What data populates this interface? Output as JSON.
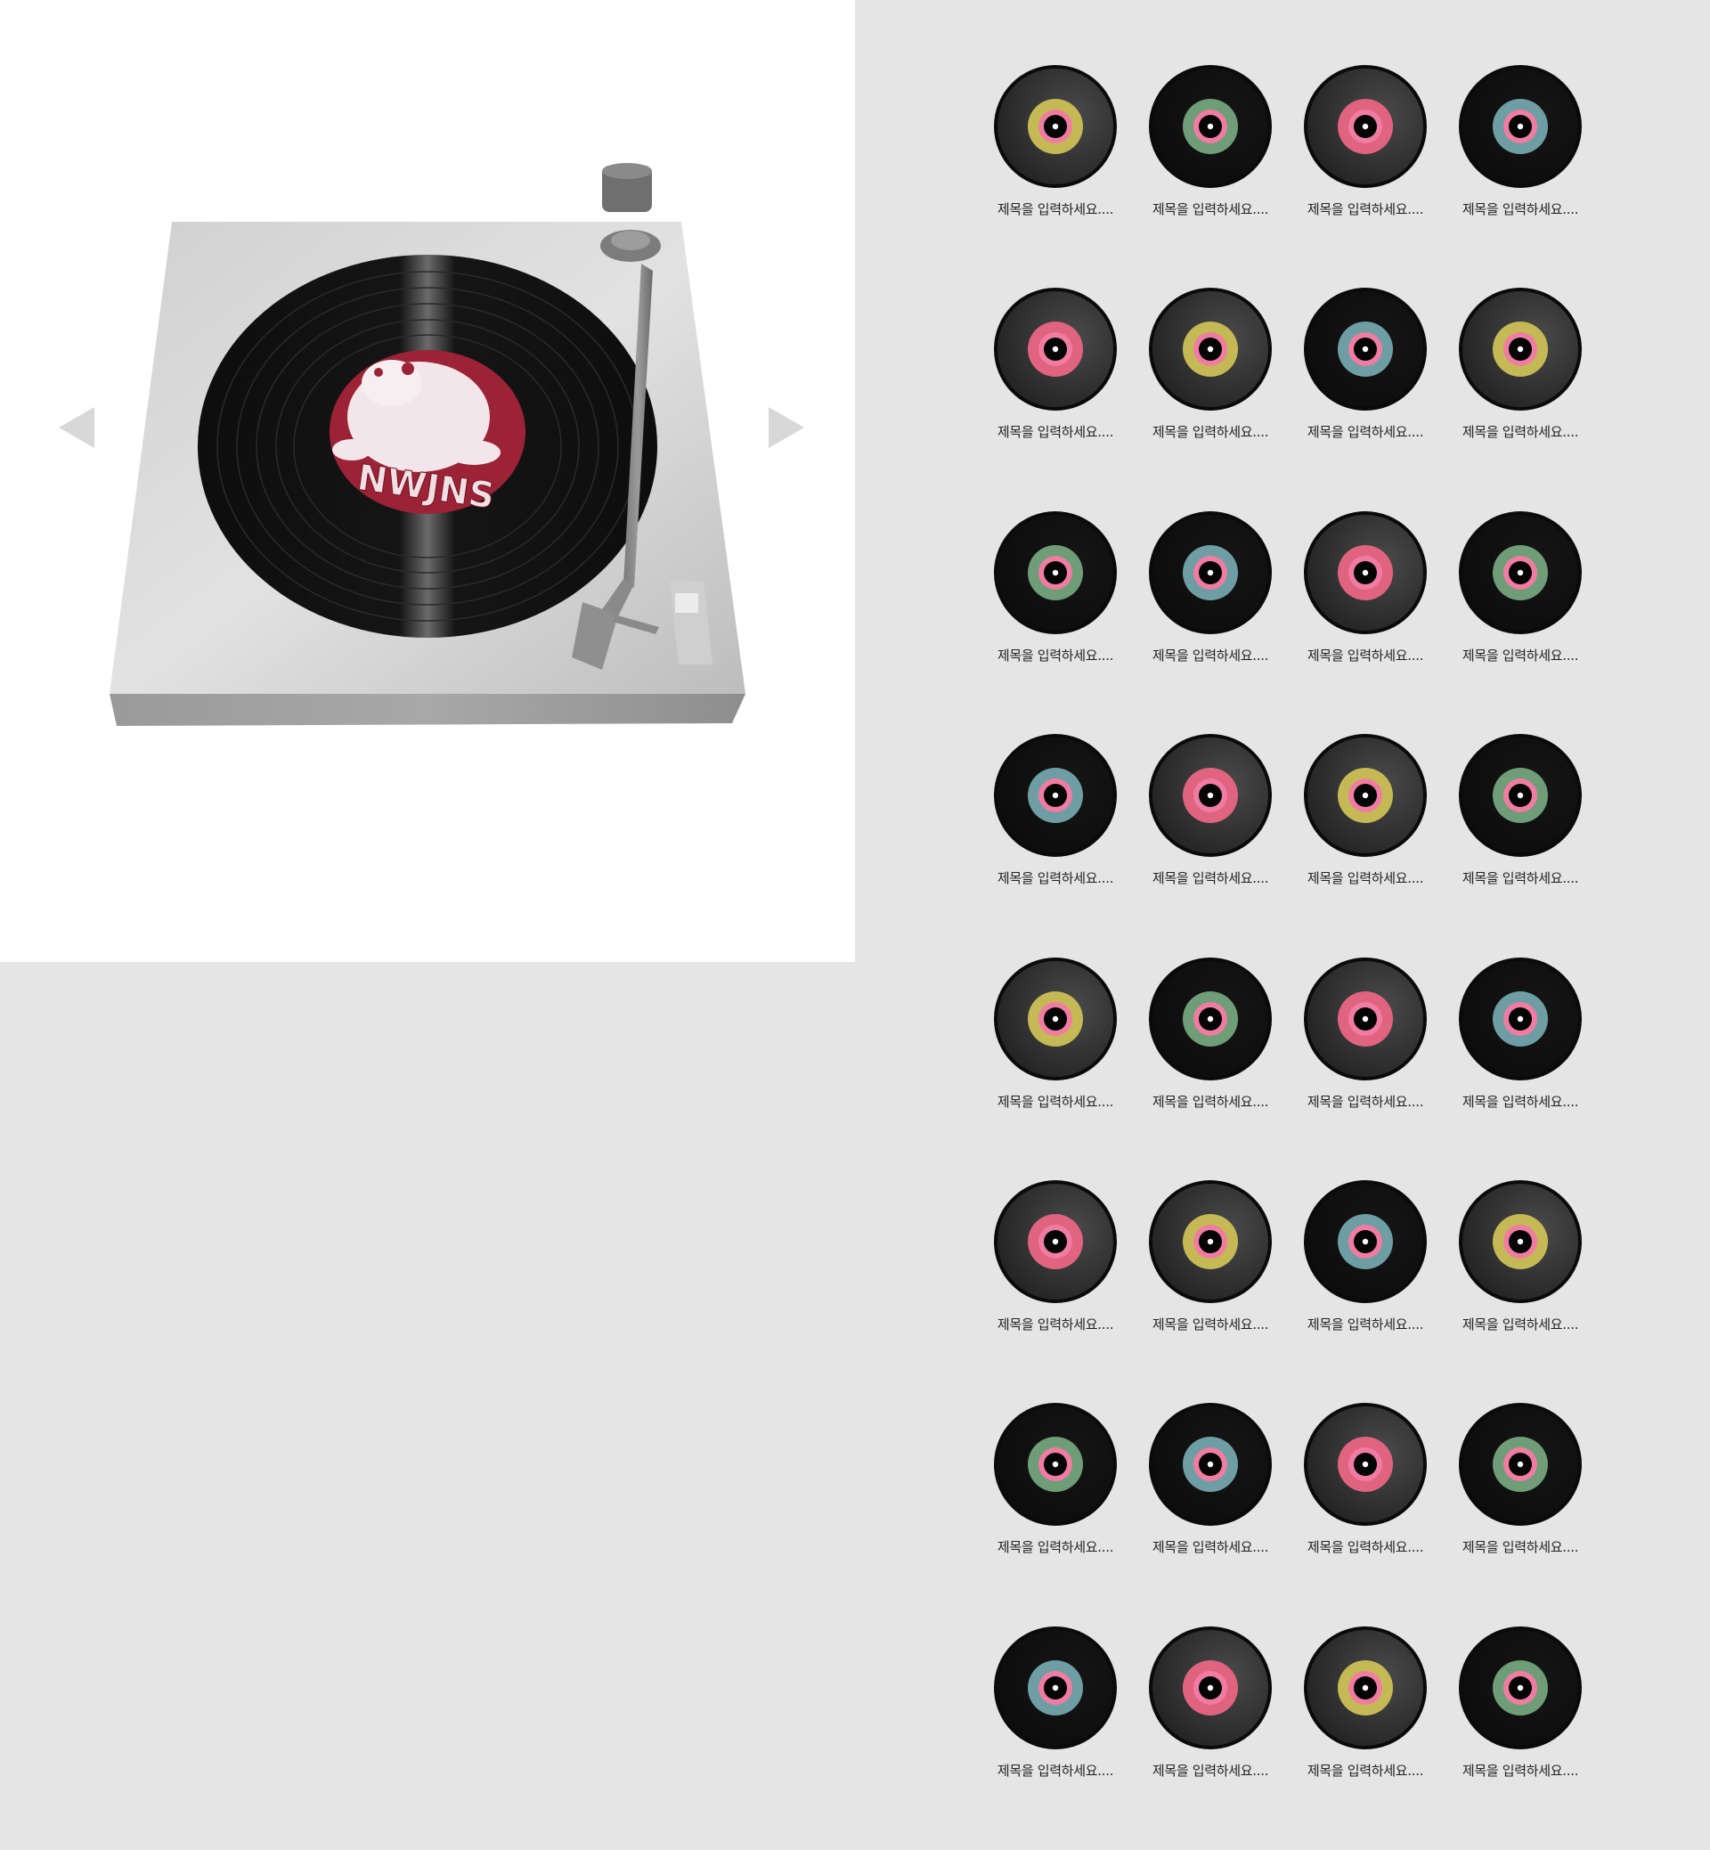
{
  "player": {
    "album_label_text": "NWJNS",
    "colors": {
      "deck": "#a9a9a9",
      "record": "#111111",
      "label": "#9b2335",
      "arrow": "#d6d6d6"
    }
  },
  "controls": {
    "prev_icon": "triangle-left-icon",
    "next_icon": "triangle-right-icon"
  },
  "ring_colors": {
    "yellow": "#c4b955",
    "green": "#6f9d77",
    "pink": "#e0647f",
    "teal": "#6e9ea3",
    "accent": "#f07ca2"
  },
  "records": [
    {
      "title": "제목을 입력하세요....",
      "ring": "yellow",
      "style": "gloss"
    },
    {
      "title": "제목을 입력하세요....",
      "ring": "green",
      "style": "flat"
    },
    {
      "title": "제목을 입력하세요....",
      "ring": "pink",
      "style": "gloss"
    },
    {
      "title": "제목을 입력하세요....",
      "ring": "teal",
      "style": "flat"
    },
    {
      "title": "제목을 입력하세요....",
      "ring": "pink",
      "style": "gloss"
    },
    {
      "title": "제목을 입력하세요....",
      "ring": "yellow",
      "style": "gloss"
    },
    {
      "title": "제목을 입력하세요....",
      "ring": "teal",
      "style": "flat"
    },
    {
      "title": "제목을 입력하세요....",
      "ring": "yellow",
      "style": "gloss"
    },
    {
      "title": "제목을 입력하세요....",
      "ring": "green",
      "style": "flat"
    },
    {
      "title": "제목을 입력하세요....",
      "ring": "teal",
      "style": "flat"
    },
    {
      "title": "제목을 입력하세요....",
      "ring": "pink",
      "style": "gloss"
    },
    {
      "title": "제목을 입력하세요....",
      "ring": "green",
      "style": "flat"
    },
    {
      "title": "제목을 입력하세요....",
      "ring": "teal",
      "style": "flat"
    },
    {
      "title": "제목을 입력하세요....",
      "ring": "pink",
      "style": "gloss"
    },
    {
      "title": "제목을 입력하세요....",
      "ring": "yellow",
      "style": "gloss"
    },
    {
      "title": "제목을 입력하세요....",
      "ring": "green",
      "style": "flat"
    },
    {
      "title": "제목을 입력하세요....",
      "ring": "yellow",
      "style": "gloss"
    },
    {
      "title": "제목을 입력하세요....",
      "ring": "green",
      "style": "flat"
    },
    {
      "title": "제목을 입력하세요....",
      "ring": "pink",
      "style": "gloss"
    },
    {
      "title": "제목을 입력하세요....",
      "ring": "teal",
      "style": "flat"
    },
    {
      "title": "제목을 입력하세요....",
      "ring": "pink",
      "style": "gloss"
    },
    {
      "title": "제목을 입력하세요....",
      "ring": "yellow",
      "style": "gloss"
    },
    {
      "title": "제목을 입력하세요....",
      "ring": "teal",
      "style": "flat"
    },
    {
      "title": "제목을 입력하세요....",
      "ring": "yellow",
      "style": "gloss"
    },
    {
      "title": "제목을 입력하세요....",
      "ring": "green",
      "style": "flat"
    },
    {
      "title": "제목을 입력하세요....",
      "ring": "teal",
      "style": "flat"
    },
    {
      "title": "제목을 입력하세요....",
      "ring": "pink",
      "style": "gloss"
    },
    {
      "title": "제목을 입력하세요....",
      "ring": "green",
      "style": "flat"
    },
    {
      "title": "제목을 입력하세요....",
      "ring": "teal",
      "style": "flat"
    },
    {
      "title": "제목을 입력하세요....",
      "ring": "pink",
      "style": "gloss"
    },
    {
      "title": "제목을 입력하세요....",
      "ring": "yellow",
      "style": "gloss"
    },
    {
      "title": "제목을 입력하세요....",
      "ring": "green",
      "style": "flat"
    }
  ]
}
